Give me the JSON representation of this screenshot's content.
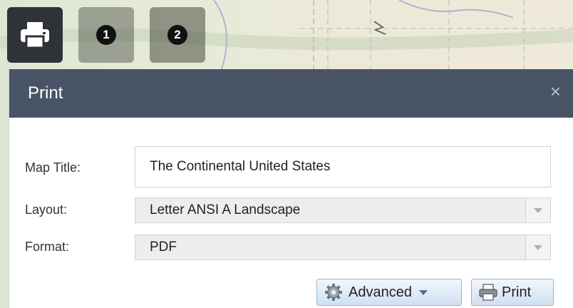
{
  "toolbar": {
    "print_tool_icon": "printer-icon",
    "bookmark_1": "1",
    "bookmark_2": "2"
  },
  "dialog": {
    "title": "Print",
    "close": "×"
  },
  "form": {
    "map_title": {
      "label": "Map Title:",
      "value": "The Continental United States"
    },
    "layout": {
      "label": "Layout:",
      "value": "Letter ANSI A Landscape"
    },
    "format": {
      "label": "Format:",
      "value": "PDF"
    }
  },
  "buttons": {
    "advanced": "Advanced",
    "print": "Print"
  },
  "colors": {
    "header": "#485466",
    "button_border": "#95b5d3"
  }
}
